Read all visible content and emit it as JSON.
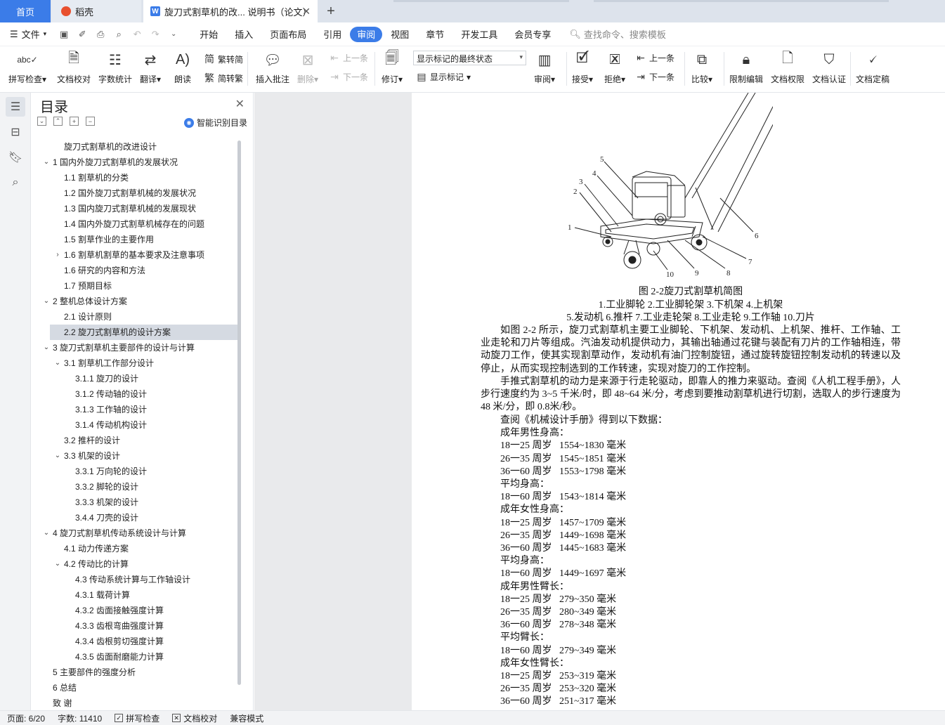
{
  "tabs": {
    "home": "首页",
    "daoke": "稻壳",
    "doc": "旋刀式割草机的改... 说明书（论文）",
    "add": "+"
  },
  "menu": {
    "file": "文件",
    "items": [
      "开始",
      "插入",
      "页面布局",
      "引用",
      "审阅",
      "视图",
      "章节",
      "开发工具",
      "会员专享"
    ],
    "active": "审阅",
    "search": "查找命令、搜索模板"
  },
  "ribbon": {
    "spell": "拼写检查",
    "proof": "文档校对",
    "wordcount": "字数统计",
    "translate": "翻译",
    "read": "朗读",
    "trad": "繁转简",
    "simp": "简转繁",
    "insert_comment": "插入批注",
    "delete": "删除",
    "prev_comment": "上一条",
    "next_comment": "下一条",
    "track": "修订",
    "markup_state": "显示标记的最终状态",
    "show_markup": "显示标记",
    "review": "审阅",
    "accept": "接受",
    "reject": "拒绝",
    "prev": "上一条",
    "next": "下一条",
    "compare": "比较",
    "restrict": "限制编辑",
    "rights": "文档权限",
    "cert": "文档认证",
    "finalize": "文档定稿"
  },
  "toc": {
    "title": "目录",
    "smart": "智能识别目录",
    "items": [
      {
        "text": "旋刀式割草机的改进设计",
        "level": 1,
        "arrow": ""
      },
      {
        "text": "1 国内外旋刀式割草机的发展状况",
        "level": 0,
        "arrow": "down"
      },
      {
        "text": "1.1 割草机的分类",
        "level": 1,
        "arrow": ""
      },
      {
        "text": "1.2 国外旋刀式割草机械的发展状况",
        "level": 1,
        "arrow": ""
      },
      {
        "text": "1.3 国内旋刀式割草机械的发展现状",
        "level": 1,
        "arrow": ""
      },
      {
        "text": "1.4 国内外旋刀式割草机械存在的问题",
        "level": 1,
        "arrow": ""
      },
      {
        "text": "1.5 割草作业的主要作用",
        "level": 1,
        "arrow": ""
      },
      {
        "text": "1.6 割草机割草的基本要求及注意事项",
        "level": 1,
        "arrow": "right"
      },
      {
        "text": "1.6 研究的内容和方法",
        "level": 1,
        "arrow": ""
      },
      {
        "text": "1.7 预期目标",
        "level": 1,
        "arrow": ""
      },
      {
        "text": "2 整机总体设计方案",
        "level": 0,
        "arrow": "down"
      },
      {
        "text": "2.1 设计原则",
        "level": 1,
        "arrow": ""
      },
      {
        "text": "2.2 旋刀式割草机的设计方案",
        "level": 1,
        "arrow": "",
        "selected": true
      },
      {
        "text": "3 旋刀式割草机主要部件的设计与计算",
        "level": 0,
        "arrow": "down"
      },
      {
        "text": "3.1 割草机工作部分设计",
        "level": 1,
        "arrow": "down"
      },
      {
        "text": "3.1.1 旋刀的设计",
        "level": 2,
        "arrow": ""
      },
      {
        "text": "3.1.2 传动轴的设计",
        "level": 2,
        "arrow": ""
      },
      {
        "text": "3.1.3 工作轴的设计",
        "level": 2,
        "arrow": ""
      },
      {
        "text": "3.1.4 传动机构设计",
        "level": 2,
        "arrow": ""
      },
      {
        "text": "3.2 推杆的设计",
        "level": 1,
        "arrow": ""
      },
      {
        "text": "3.3 机架的设计",
        "level": 1,
        "arrow": "down"
      },
      {
        "text": "3.3.1 万向轮的设计",
        "level": 2,
        "arrow": ""
      },
      {
        "text": "3.3.2 脚轮的设计",
        "level": 2,
        "arrow": ""
      },
      {
        "text": "3.3.3 机架的设计",
        "level": 2,
        "arrow": ""
      },
      {
        "text": "3.4.4 刀壳的设计",
        "level": 2,
        "arrow": ""
      },
      {
        "text": "4 旋刀式割草机传动系统设计与计算",
        "level": 0,
        "arrow": "down"
      },
      {
        "text": "4.1 动力传递方案",
        "level": 1,
        "arrow": ""
      },
      {
        "text": "4.2 传动比的计算",
        "level": 1,
        "arrow": "down"
      },
      {
        "text": "4.3 传动系统计算与工作轴设计",
        "level": 2,
        "arrow": ""
      },
      {
        "text": "4.3.1 载荷计算",
        "level": 2,
        "arrow": ""
      },
      {
        "text": "4.3.2 齿面接触强度计算",
        "level": 2,
        "arrow": ""
      },
      {
        "text": "4.3.3 齿根弯曲强度计算",
        "level": 2,
        "arrow": ""
      },
      {
        "text": "4.3.4 齿根剪切强度计算",
        "level": 2,
        "arrow": ""
      },
      {
        "text": "4.3.5 齿面耐磨能力计算",
        "level": 2,
        "arrow": ""
      },
      {
        "text": "5 主要部件的强度分析",
        "level": 0,
        "arrow": ""
      },
      {
        "text": "6 总结",
        "level": 0,
        "arrow": ""
      },
      {
        "text": "致 谢",
        "level": 0,
        "arrow": ""
      }
    ]
  },
  "figure": {
    "labels": [
      "1",
      "2",
      "3",
      "4",
      "5",
      "6",
      "7",
      "8",
      "9",
      "10"
    ],
    "caption": "图 2-2旋刀式割草机简图",
    "legend1": "1.工业脚轮 2.工业脚轮架 3.下机架 4.上机架",
    "legend2": "5.发动机 6.推杆 7.工业走轮架  8.工业走轮 9.工作轴 10.刀片"
  },
  "body": {
    "p1": "如图 2-2 所示，旋刀式割草机主要工业脚轮、下机架、发动机、上机架、推杆、工作轴、工业走轮和刀片等组成。汽油发动机提供动力，其输出轴通过花键与装配有刀片的工作轴相连，带动旋刀工作，使其实现割草动作，发动机有油门控制旋钮，通过旋转旋钮控制发动机的转速以及停止，从而实现控制选到的工作转速，实现对旋刀的工作控制。",
    "p2": "手推式割草机的动力是来源于行走轮驱动，即靠人的推力来驱动。查阅《人机工程手册》，人步行速度约为 3~5 千米/时，即 48~64 米/分，考虑到要推动割草机进行切割，选取人的步行速度为 48 米/分，即 0.8米/秒。",
    "lines": [
      "查阅《机械设计手册》得到以下数据：",
      "成年男性身高：",
      "18一25 周岁   1554~1830 毫米",
      "26一35 周岁   1545~1851 毫米",
      "36一60 周岁   1553~1798 毫米",
      "平均身高：",
      "18一60 周岁   1543~1814 毫米",
      "成年女性身高：",
      "18一25 周岁   1457~1709 毫米",
      "26一35 周岁   1449~1698 毫米",
      "36一60 周岁   1445~1683 毫米",
      "平均身高：",
      "18一60 周岁   1449~1697 毫米",
      "成年男性臂长：",
      "18一25 周岁   279~350 毫米",
      "26一35 周岁   280~349 毫米",
      "36一60 周岁   278~348 毫米",
      "平均臂长：",
      "18一60 周岁   279~349 毫米",
      "成年女性臂长：",
      "18一25 周岁   253~319 毫米",
      "26一35 周岁   253~320 毫米",
      "36一60 周岁   251~317 毫米"
    ]
  },
  "status": {
    "page": "页面: 6/20",
    "words": "字数: 11410",
    "spell": "拼写检查",
    "proof": "文档校对",
    "compat": "兼容模式"
  }
}
